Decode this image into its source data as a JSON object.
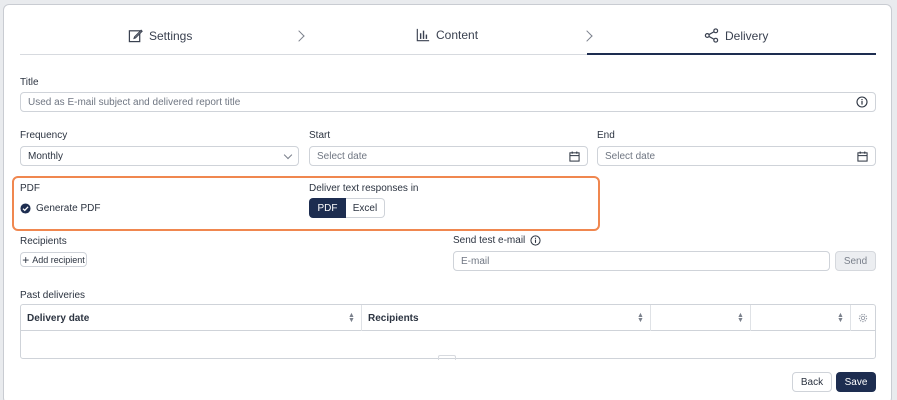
{
  "tabs": [
    {
      "label": "Settings",
      "icon": "edit-icon"
    },
    {
      "label": "Content",
      "icon": "bar-chart-icon"
    },
    {
      "label": "Delivery",
      "icon": "share-icon"
    }
  ],
  "active_tab": "Delivery",
  "title_field": {
    "label": "Title",
    "placeholder": "Used as E-mail subject and delivered report title"
  },
  "frequency": {
    "label": "Frequency",
    "value": "Monthly"
  },
  "start": {
    "label": "Start",
    "placeholder": "Select date"
  },
  "end": {
    "label": "End",
    "placeholder": "Select date"
  },
  "pdf": {
    "label": "PDF",
    "checkbox_label": "Generate PDF",
    "checked": true
  },
  "deliver_text": {
    "label": "Deliver text responses in",
    "options": [
      "PDF",
      "Excel"
    ],
    "selected": "PDF"
  },
  "recipients": {
    "label": "Recipients",
    "add_label": "Add recipient"
  },
  "test_email": {
    "label": "Send test e-mail",
    "placeholder": "E-mail",
    "send_label": "Send"
  },
  "past_deliveries": {
    "label": "Past deliveries",
    "columns": [
      "Delivery date",
      "Recipients",
      "",
      ""
    ]
  },
  "footer": {
    "back_label": "Back",
    "save_label": "Save"
  },
  "colors": {
    "accent": "#1d2d50",
    "highlight": "#f0874f"
  }
}
